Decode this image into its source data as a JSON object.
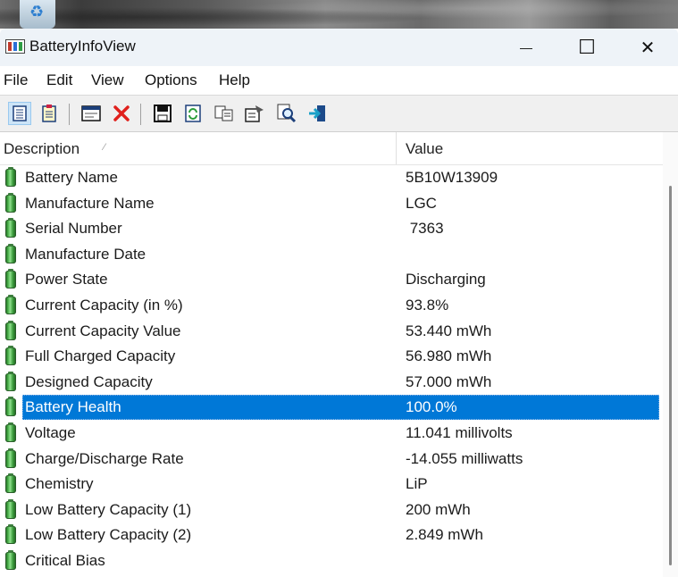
{
  "window": {
    "title": "BatteryInfoView",
    "minimize_glyph": "—",
    "maximize_glyph": "☐",
    "close_glyph": "✕"
  },
  "menu": [
    "File",
    "Edit",
    "View",
    "Options",
    "Help"
  ],
  "toolbar": {
    "icons": [
      "properties-icon",
      "log-icon",
      "html-report-icon",
      "delete-icon",
      "save-icon",
      "refresh-icon",
      "copy-icon",
      "options-icon",
      "find-icon",
      "exit-icon"
    ]
  },
  "table": {
    "columns": [
      "Description",
      "Value"
    ],
    "sorted_column": "Description",
    "selected_row": "Battery Health",
    "rows": [
      {
        "description": "Battery Name",
        "value": "5B10W13909"
      },
      {
        "description": "Manufacture Name",
        "value": "LGC"
      },
      {
        "description": "Serial Number",
        "value": " 7363"
      },
      {
        "description": "Manufacture Date",
        "value": ""
      },
      {
        "description": "Power State",
        "value": "Discharging"
      },
      {
        "description": "Current Capacity (in %)",
        "value": "93.8%"
      },
      {
        "description": "Current Capacity Value",
        "value": "53.440 mWh"
      },
      {
        "description": "Full Charged Capacity",
        "value": "56.980 mWh"
      },
      {
        "description": "Designed Capacity",
        "value": "57.000 mWh"
      },
      {
        "description": "Battery Health",
        "value": "100.0%"
      },
      {
        "description": "Voltage",
        "value": "11.041 millivolts"
      },
      {
        "description": "Charge/Discharge Rate",
        "value": "-14.055 milliwatts"
      },
      {
        "description": "Chemistry",
        "value": "LiP"
      },
      {
        "description": "Low Battery Capacity (1)",
        "value": "200 mWh"
      },
      {
        "description": "Low Battery Capacity (2)",
        "value": "2.849 mWh"
      },
      {
        "description": "Critical Bias",
        "value": ""
      }
    ]
  },
  "colors": {
    "selection": "#0078d7",
    "titlebar": "#eef3f8",
    "toolbar": "#f0f0f0"
  }
}
